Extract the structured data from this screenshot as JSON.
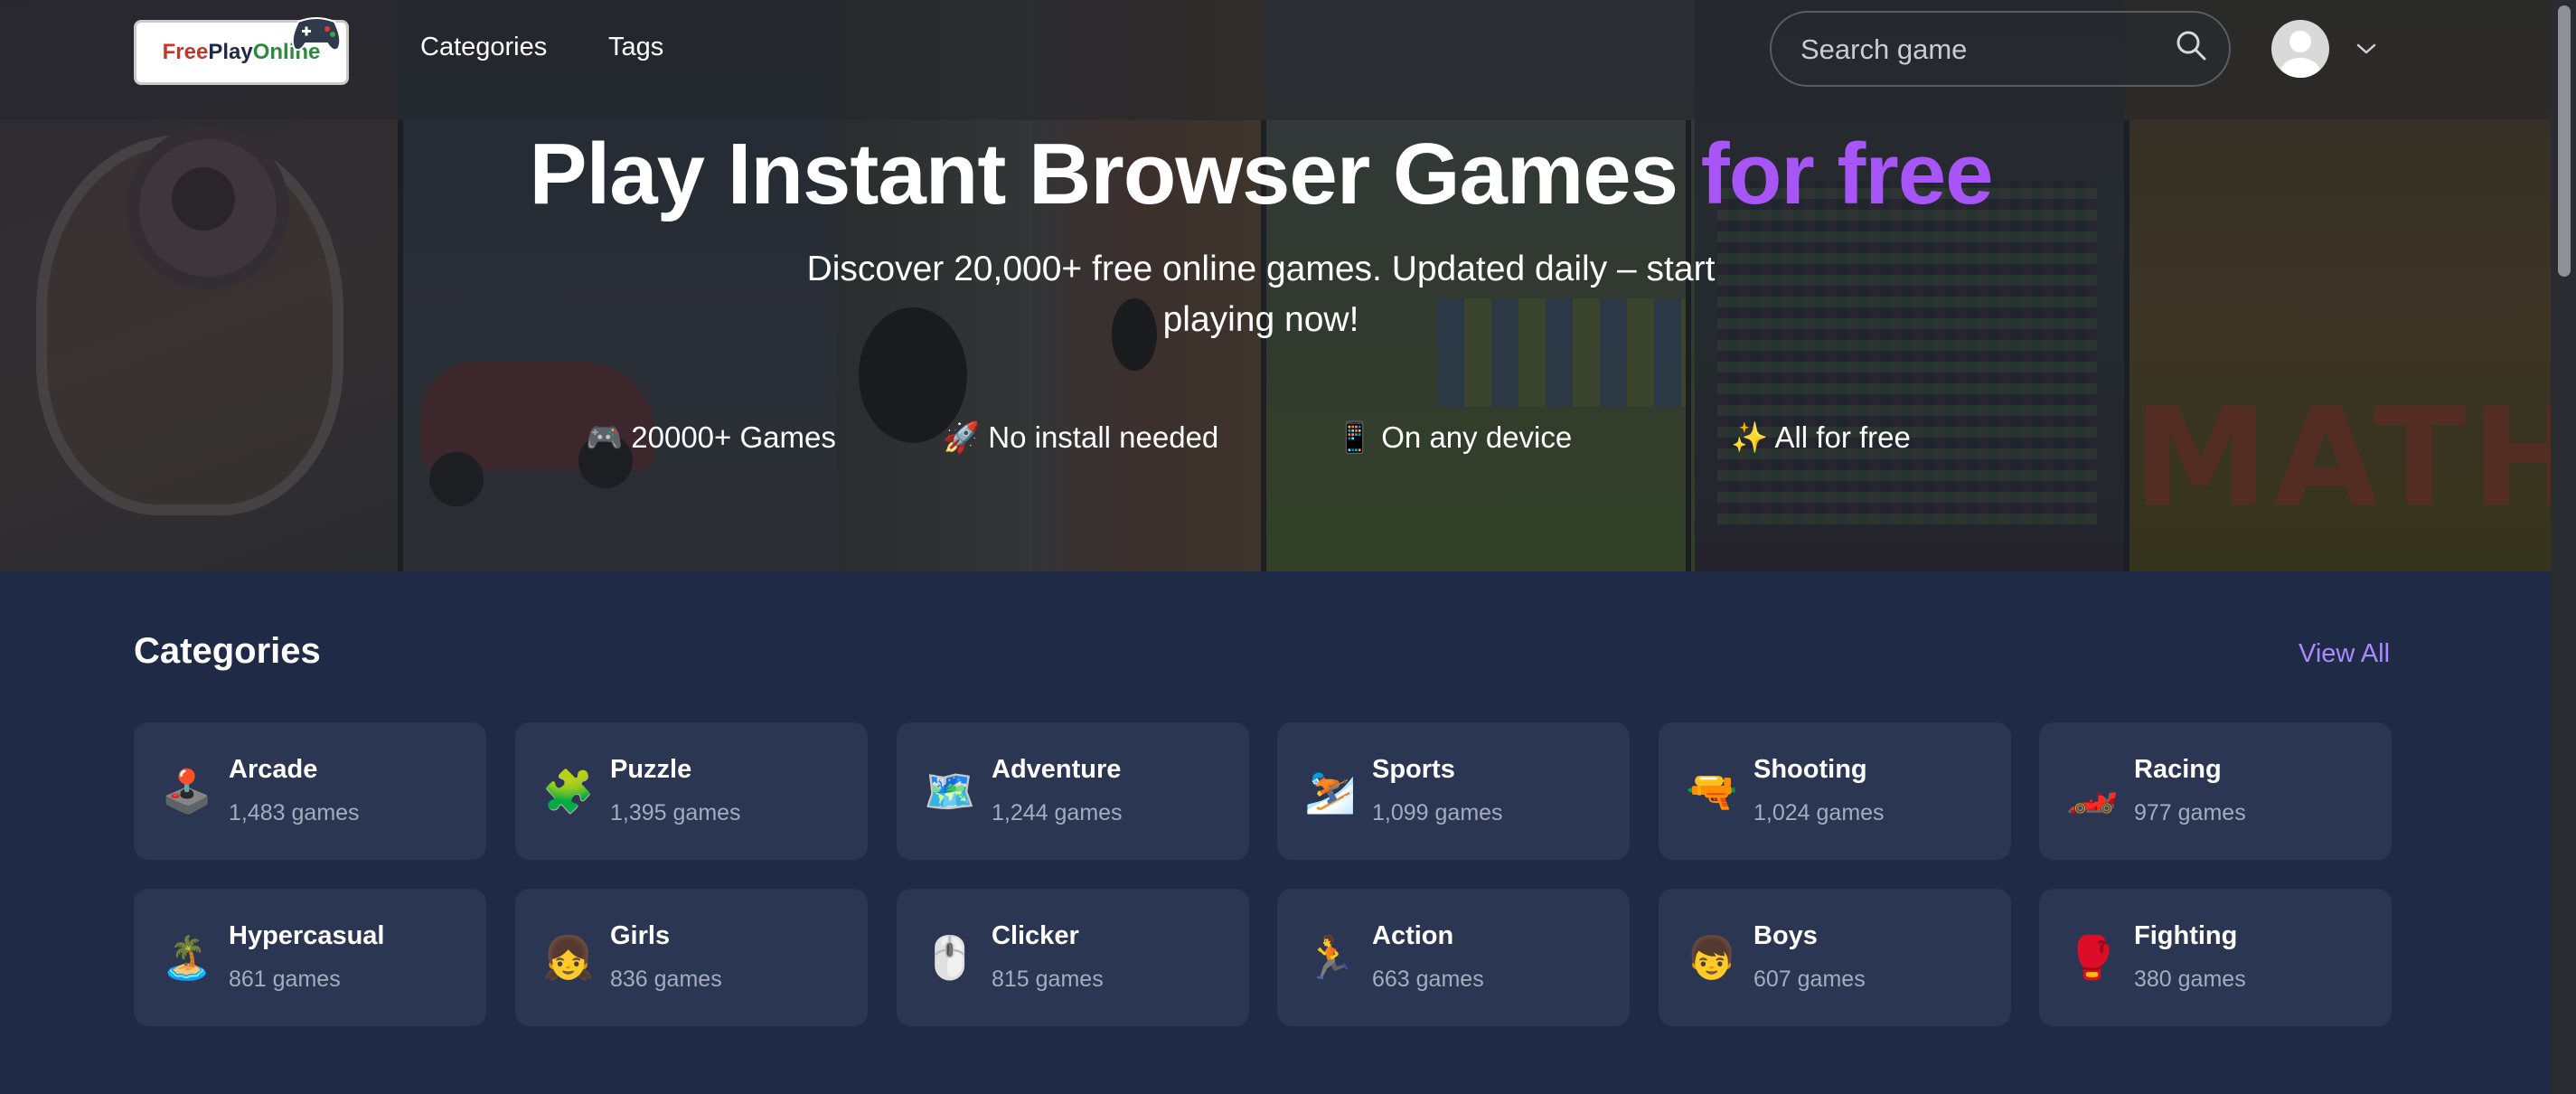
{
  "nav": {
    "logo": {
      "free": "Free",
      "play": "Play",
      "online": "Online"
    },
    "links": [
      "Categories",
      "Tags"
    ],
    "search_placeholder": "Search game"
  },
  "hero": {
    "title_main": "Play Instant Browser Games ",
    "title_highlight": "for free",
    "subtitle": "Discover 20,000+ free online games. Updated daily – start playing now!",
    "features": [
      {
        "icon": "🎮",
        "text": "20000+ Games"
      },
      {
        "icon": "🚀",
        "text": "No install needed"
      },
      {
        "icon": "📱",
        "text": "On any device"
      },
      {
        "icon": "✨",
        "text": "All for free"
      }
    ],
    "background_text": "MATH"
  },
  "categories": {
    "heading": "Categories",
    "view_all": "View All",
    "items": [
      {
        "icon": "🕹️",
        "name": "Arcade",
        "count": "1,483 games"
      },
      {
        "icon": "🧩",
        "name": "Puzzle",
        "count": "1,395 games"
      },
      {
        "icon": "🗺️",
        "name": "Adventure",
        "count": "1,244 games"
      },
      {
        "icon": "⛷️",
        "name": "Sports",
        "count": "1,099 games"
      },
      {
        "icon": "🔫",
        "name": "Shooting",
        "count": "1,024 games"
      },
      {
        "icon": "🏎️",
        "name": "Racing",
        "count": "977 games"
      },
      {
        "icon": "🏝️",
        "name": "Hypercasual",
        "count": "861 games"
      },
      {
        "icon": "👧",
        "name": "Girls",
        "count": "836 games"
      },
      {
        "icon": "🖱️",
        "name": "Clicker",
        "count": "815 games"
      },
      {
        "icon": "🏃",
        "name": "Action",
        "count": "663 games"
      },
      {
        "icon": "👦",
        "name": "Boys",
        "count": "607 games"
      },
      {
        "icon": "🥊",
        "name": "Fighting",
        "count": "380 games"
      }
    ]
  },
  "colors": {
    "accent": "#a855f7",
    "link": "#a78bfa",
    "background": "#1f2a47",
    "card": "#2b3652"
  }
}
